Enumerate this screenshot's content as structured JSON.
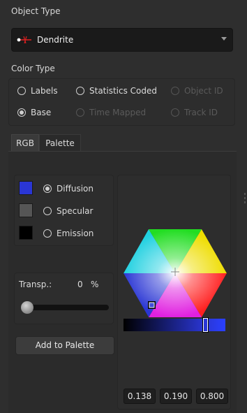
{
  "object_type": {
    "title": "Object Type",
    "selected": "Dendrite",
    "icon": "dendrite-icon"
  },
  "color_type": {
    "title": "Color Type",
    "options": [
      {
        "label": "Labels",
        "checked": false,
        "enabled": true
      },
      {
        "label": "Statistics Coded",
        "checked": false,
        "enabled": true
      },
      {
        "label": "Object ID",
        "checked": false,
        "enabled": false
      },
      {
        "label": "Base",
        "checked": true,
        "enabled": true
      },
      {
        "label": "Time Mapped",
        "checked": false,
        "enabled": false
      },
      {
        "label": "Track ID",
        "checked": false,
        "enabled": false
      }
    ]
  },
  "tabs": [
    {
      "label": "RGB",
      "active": true
    },
    {
      "label": "Palette",
      "active": false
    }
  ],
  "material": {
    "options": [
      {
        "label": "Diffusion",
        "checked": true,
        "swatch": "#2a36d4"
      },
      {
        "label": "Specular",
        "checked": false,
        "swatch": "#555555"
      },
      {
        "label": "Emission",
        "checked": false,
        "swatch": "#000000"
      }
    ]
  },
  "transparency": {
    "label": "Transp.:",
    "value": "0",
    "unit": "%"
  },
  "add_button": "Add to Palette",
  "color_values": [
    "0.138",
    "0.190",
    "0.800"
  ],
  "brightness_level": 0.8,
  "colors": {
    "background": "#2e2e2e",
    "selected_color": "#2a36d4"
  }
}
